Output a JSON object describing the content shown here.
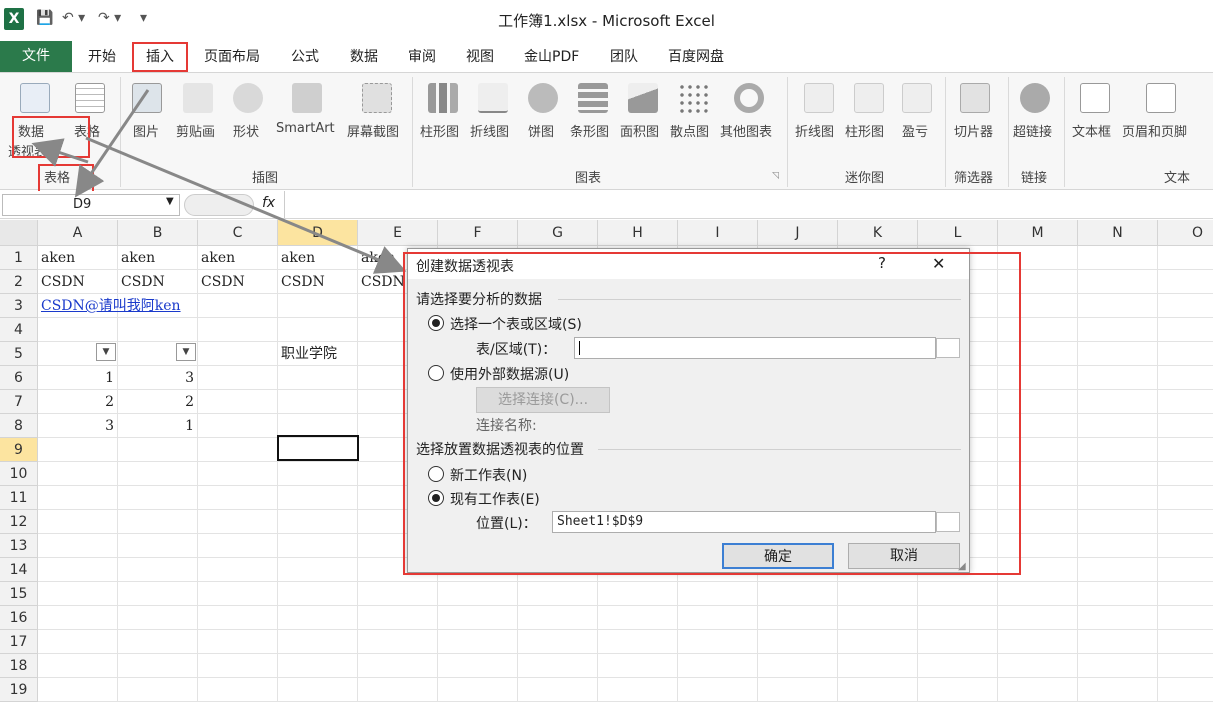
{
  "window": {
    "title": "工作簿1.xlsx - Microsoft Excel",
    "logo": "X"
  },
  "quick_access": {
    "save_icon": "save-icon",
    "undo_icon": "undo-icon",
    "redo_icon": "redo-icon"
  },
  "tabs": {
    "file": "文件",
    "items": [
      "开始",
      "插入",
      "页面布局",
      "公式",
      "数据",
      "审阅",
      "视图",
      "金山PDF",
      "团队",
      "百度网盘"
    ]
  },
  "ribbon": {
    "tables": {
      "pivot": "数据",
      "pivot2": "透视表",
      "table": "表格",
      "group": "表格"
    },
    "illustrations": {
      "picture": "图片",
      "clipart": "剪贴画",
      "shapes": "形状",
      "smartart": "SmartArt",
      "screenshot": "屏幕截图",
      "group": "插图"
    },
    "charts": {
      "column": "柱形图",
      "line": "折线图",
      "pie": "饼图",
      "bar": "条形图",
      "area": "面积图",
      "scatter": "散点图",
      "other": "其他图表",
      "group": "图表"
    },
    "sparklines": {
      "line": "折线图",
      "column": "柱形图",
      "winloss": "盈亏",
      "group": "迷你图"
    },
    "filter": {
      "slicer": "切片器",
      "group": "筛选器"
    },
    "links": {
      "hyperlink": "超链接",
      "group": "链接"
    },
    "text": {
      "textbox": "文本框",
      "header": "页眉和页脚",
      "group": "文本"
    }
  },
  "formula_bar": {
    "name_box": "D9",
    "fx": "fx",
    "formula": ""
  },
  "sheet": {
    "columns": [
      "A",
      "B",
      "C",
      "D",
      "E",
      "F",
      "G",
      "H",
      "I",
      "J",
      "K",
      "L",
      "M",
      "N",
      "O"
    ],
    "rows": [
      "1",
      "2",
      "3",
      "4",
      "5",
      "6",
      "7",
      "8",
      "9",
      "10",
      "11",
      "12",
      "13",
      "14",
      "15",
      "16",
      "17",
      "18",
      "19"
    ],
    "cells": {
      "A1": "aken",
      "B1": "aken",
      "C1": "aken",
      "D1": "aken",
      "E1": "aken",
      "A2": "CSDN",
      "B2": "CSDN",
      "C2": "CSDN",
      "D2": "CSDN",
      "E2": "CSDN",
      "A3": "CSDN@请叫我阿ken",
      "D5": "职业学院",
      "A6": "1",
      "B6": "3",
      "A7": "2",
      "B7": "2",
      "A8": "3",
      "B8": "1"
    }
  },
  "dialog": {
    "title": "创建数据透视表",
    "help": "?",
    "close": "✕",
    "section1": "请选择要分析的数据",
    "opt_range": "选择一个表或区域(S)",
    "range_label": "表/区域(T)：",
    "range_value": "",
    "opt_external": "使用外部数据源(U)",
    "choose_conn": "选择连接(C)...",
    "conn_name": "连接名称:",
    "section2": "选择放置数据透视表的位置",
    "opt_new": "新工作表(N)",
    "opt_existing": "现有工作表(E)",
    "location_label": "位置(L)：",
    "location_value": "Sheet1!$D$9",
    "ok": "确定",
    "cancel": "取消"
  },
  "colors": {
    "accent": "#e53935",
    "file_tab": "#2b7a4b",
    "selected_header": "#fce4a0"
  }
}
